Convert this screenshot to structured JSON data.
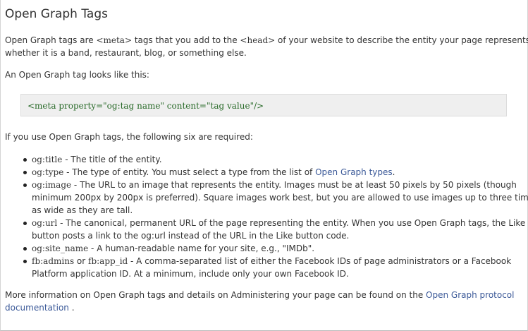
{
  "title": "Open Graph Tags",
  "intro": {
    "l1_a": "Open Graph tags are ",
    "l1_code1": "<meta>",
    "l1_b": " tags that you add to the ",
    "l1_code2": "<head>",
    "l1_c": " of your website to describe the entity your page represents,",
    "l2": "whether it is a band, restaurant, blog, or something else."
  },
  "example_label": "An Open Graph tag looks like this:",
  "code_example": "<meta property=\"og:tag name\" content=\"tag value\"/>",
  "required_label": "If you use Open Graph tags, the following six are required:",
  "items": [
    {
      "code": "og:title",
      "lines": [
        " - The title of the entity."
      ]
    },
    {
      "code": "og:type",
      "text_before_link": " - The type of entity. You must select a type from the list of ",
      "link": "Open Graph types",
      "text_after_link": "."
    },
    {
      "code": "og:image",
      "lines": [
        " - The URL to an image that represents the entity. Images must be at least 50 pixels by 50 pixels (though",
        "minimum 200px by 200px is preferred). Square images work best, but you are allowed to use images up to three times",
        "as wide as they are tall."
      ]
    },
    {
      "code": "og:url",
      "lines": [
        " - The canonical, permanent URL of the page representing the entity. When you use Open Graph tags, the Like",
        "button posts a link to the og:url instead of the URL in the Like button code."
      ]
    },
    {
      "code": "og:site_name",
      "lines": [
        " - A human-readable name for your site, e.g., \"IMDb\"."
      ]
    },
    {
      "code": "fb:admins",
      "connector": " or ",
      "code2": "fb:app_id",
      "lines": [
        " - A comma-separated list of either the Facebook IDs of page administrators or a Facebook",
        "Platform application ID. At a minimum, include only your own Facebook ID."
      ]
    }
  ],
  "footer": {
    "text": "More information on Open Graph tags and details on Administering your page can be found on the ",
    "link_l1": "Open Graph protocol",
    "link_l2": "documentation",
    "end": " ."
  }
}
